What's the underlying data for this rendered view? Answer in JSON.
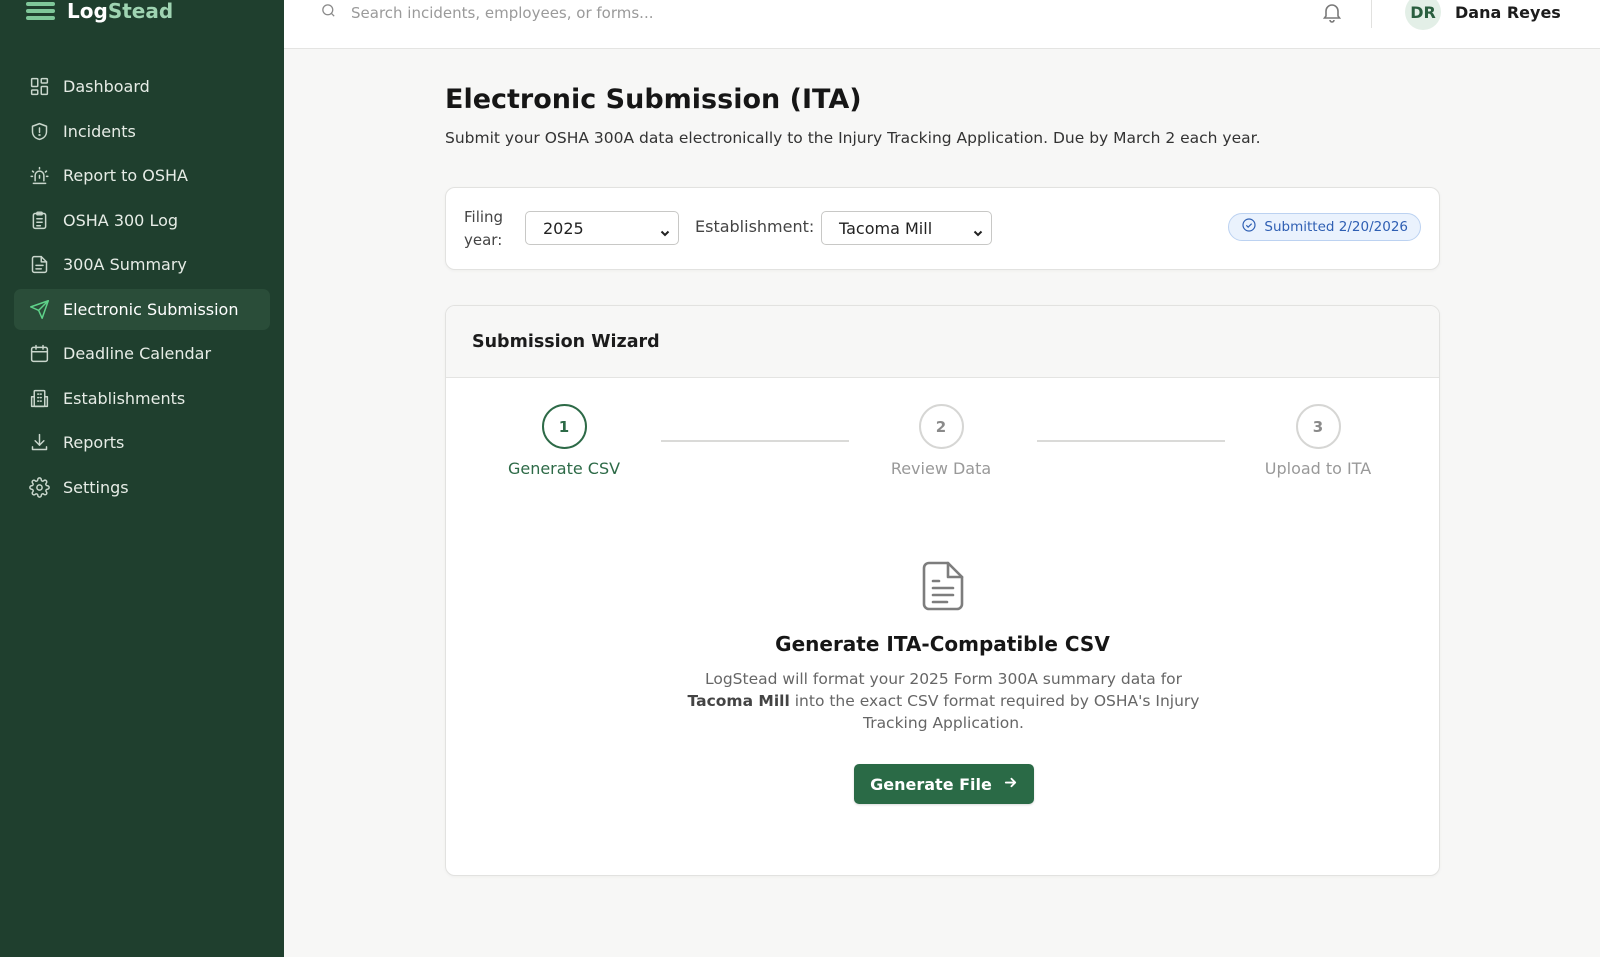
{
  "app": {
    "brand_prefix": "Log",
    "brand_suffix": "Stead",
    "brand_color": "#1f3f2e",
    "accent_color": "#2a6a46"
  },
  "sidebar": {
    "items": [
      {
        "label": "Dashboard",
        "icon": "grid-icon",
        "active": false
      },
      {
        "label": "Incidents",
        "icon": "shield-icon",
        "active": false
      },
      {
        "label": "Report to OSHA",
        "icon": "siren-icon",
        "active": false
      },
      {
        "label": "OSHA 300 Log",
        "icon": "clipboard-icon",
        "active": false
      },
      {
        "label": "300A Summary",
        "icon": "document-icon",
        "active": false
      },
      {
        "label": "Electronic Submission",
        "icon": "send-icon",
        "active": true
      },
      {
        "label": "Deadline Calendar",
        "icon": "calendar-icon",
        "active": false
      },
      {
        "label": "Establishments",
        "icon": "building-icon",
        "active": false
      },
      {
        "label": "Reports",
        "icon": "download-icon",
        "active": false
      },
      {
        "label": "Settings",
        "icon": "gear-icon",
        "active": false
      }
    ]
  },
  "topbar": {
    "search_placeholder": "Search incidents, employees, or forms...",
    "user_initials": "DR",
    "user_name": "Dana Reyes"
  },
  "page": {
    "title": "Electronic Submission (ITA)",
    "subtitle": "Submit your OSHA 300A data electronically to the Injury Tracking Application. Due by March 2 each year."
  },
  "filters": {
    "year_label": "Filing year:",
    "year_value": "2025",
    "establishment_label": "Establishment:",
    "establishment_value": "Tacoma Mill",
    "status": "Submitted 2/20/2026"
  },
  "wizard": {
    "title": "Submission Wizard",
    "steps": [
      {
        "number": "1",
        "label": "Generate CSV",
        "state": "active"
      },
      {
        "number": "2",
        "label": "Review Data",
        "state": "pending"
      },
      {
        "number": "3",
        "label": "Upload to ITA",
        "state": "pending"
      }
    ],
    "panel": {
      "icon": "file-text-icon",
      "title": "Generate ITA-Compatible CSV",
      "desc_before": "LogStead will format your 2025 Form 300A summary data for",
      "desc_bold": "Tacoma Mill",
      "desc_after": "into the exact CSV format required by OSHA's Injury Tracking Application.",
      "button_label": "Generate File"
    }
  }
}
